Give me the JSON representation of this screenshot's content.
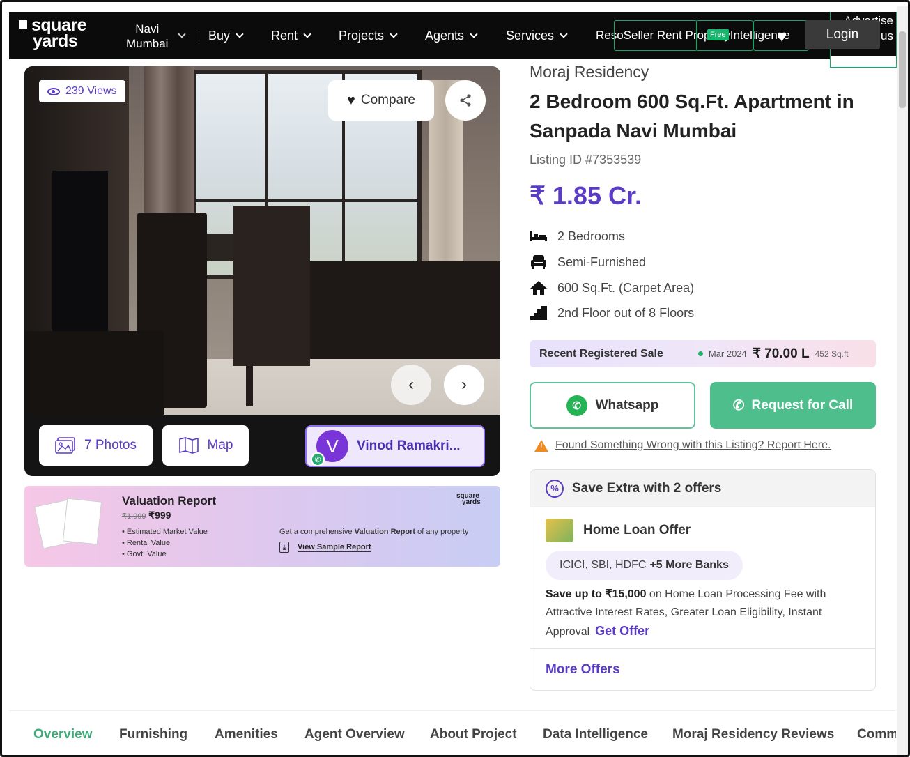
{
  "header": {
    "logo_line1": "square",
    "logo_line2": "yards",
    "city_line1": "Navi",
    "city_line2": "Mumbai",
    "nav": [
      "Buy",
      "Rent",
      "Projects",
      "Agents",
      "Services"
    ],
    "overlap_text": "ResoSeller Rent PropertyIntelligence",
    "free_badge": "Free",
    "login": "Login",
    "advertise_line1": "Advertise",
    "advertise_line2": "with us"
  },
  "gallery": {
    "views": "239 Views",
    "compare": "Compare",
    "photos": "7 Photos",
    "map": "Map",
    "agent_initial": "V",
    "agent_name": "Vinod Ramakri..."
  },
  "valuation": {
    "title": "Valuation Report",
    "old_price": "₹1,999",
    "new_price": "₹999",
    "items": [
      "Estimated Market Value",
      "Rental Value",
      "Govt. Value"
    ],
    "logo_line1": "square",
    "logo_line2": "yards",
    "desc_pre": "Get a comprehensive ",
    "desc_bold": "Valuation Report",
    "desc_post": " of any property",
    "link": "View Sample Report"
  },
  "listing": {
    "project": "Moraj Residency",
    "title": "2 Bedroom 600 Sq.Ft. Apartment in Sanpada Navi Mumbai",
    "listing_id": "Listing ID #7353539",
    "price": "₹ 1.85 Cr.",
    "features": [
      "2 Bedrooms",
      "Semi-Furnished",
      "600 Sq.Ft. (Carpet Area)",
      "2nd Floor out of 8 Floors"
    ]
  },
  "recent_sale": {
    "label": "Recent Registered Sale",
    "date": "Mar 2024",
    "amount": "₹ 70.00 L",
    "size": "452 Sq.ft"
  },
  "actions": {
    "whatsapp": "Whatsapp",
    "call": "Request for Call",
    "report": "Found Something Wrong with this Listing? Report Here."
  },
  "offers": {
    "heading": "Save Extra with 2 offers",
    "home_loan": "Home Loan Offer",
    "banks": "ICICI, SBI, HDFC",
    "banks_more": "+5 More Banks",
    "save_bold": "Save up to ₹15,000",
    "save_rest": " on Home Loan Processing Fee with Attractive Interest Rates, Greater Loan Eligibility, Instant Approval",
    "get_offer": "Get Offer",
    "more": "More Offers"
  },
  "tabs": [
    "Overview",
    "Furnishing",
    "Amenities",
    "Agent Overview",
    "About Project",
    "Data Intelligence",
    "Moraj Residency Reviews",
    "Comm"
  ],
  "colors": {
    "accent": "#5b3cc4",
    "green": "#4dbe8c",
    "header_bg": "#0b0b0b"
  }
}
